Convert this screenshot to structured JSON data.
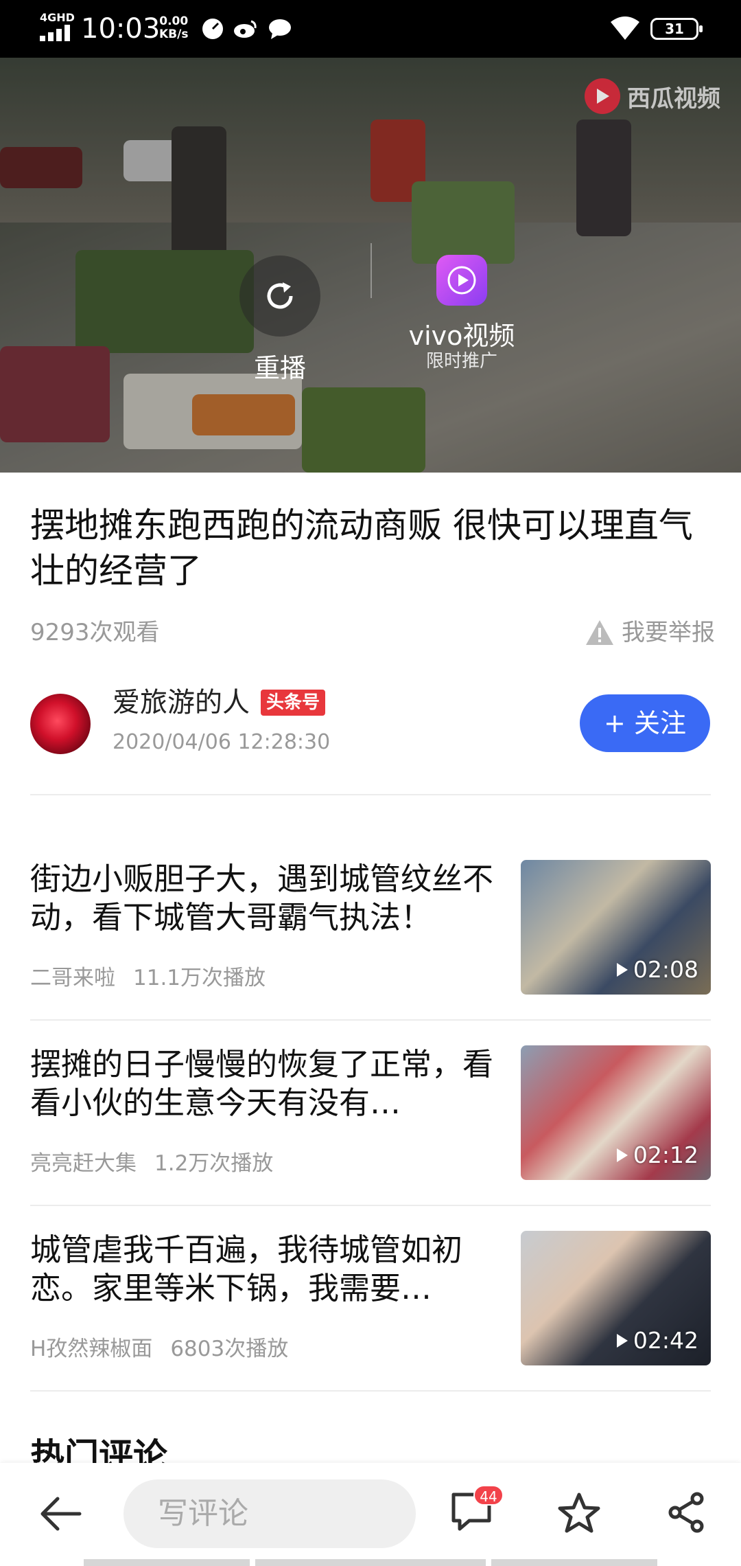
{
  "status_bar": {
    "network": "4GHD",
    "time": "10:03",
    "speed_value": "0.00",
    "speed_unit": "KB/s",
    "battery": "31"
  },
  "video": {
    "watermark": "西瓜视频",
    "replay_label": "重播",
    "promo_label": "vivo视频",
    "promo_sub": "限时推广"
  },
  "article": {
    "title": "摆地摊东跑西跑的流动商贩 很快可以理直气壮的经营了",
    "views": "9293次观看",
    "report": "我要举报"
  },
  "author": {
    "name": "爱旅游的人",
    "badge": "头条号",
    "date": "2020/04/06 12:28:30",
    "follow_label": "+ 关注"
  },
  "related": [
    {
      "title": "街边小贩胆子大，遇到城管纹丝不动，看下城管大哥霸气执法！",
      "source": "二哥来啦",
      "plays": "11.1万次播放",
      "duration": "02:08"
    },
    {
      "title": "摆摊的日子慢慢的恢复了正常，看看小伙的生意今天有没有…",
      "source": "亮亮赶大集",
      "plays": "1.2万次播放",
      "duration": "02:12"
    },
    {
      "title": "城管虐我千百遍，我待城管如初恋。家里等米下锅，我需要…",
      "source": "H孜然辣椒面",
      "plays": "6803次播放",
      "duration": "02:42"
    }
  ],
  "comments_section_title": "热门评论",
  "bottom_bar": {
    "input_placeholder": "写评论",
    "comment_count": "44"
  },
  "icons": {
    "back": "arrow-left-icon",
    "comment": "comment-bubble-icon",
    "favorite": "star-icon",
    "share": "share-icon",
    "replay": "replay-icon",
    "report": "warning-triangle-icon"
  },
  "colors": {
    "follow_button": "#3a6af5",
    "badge": "#e8373c",
    "comment_count_badge": "#f2424a"
  }
}
